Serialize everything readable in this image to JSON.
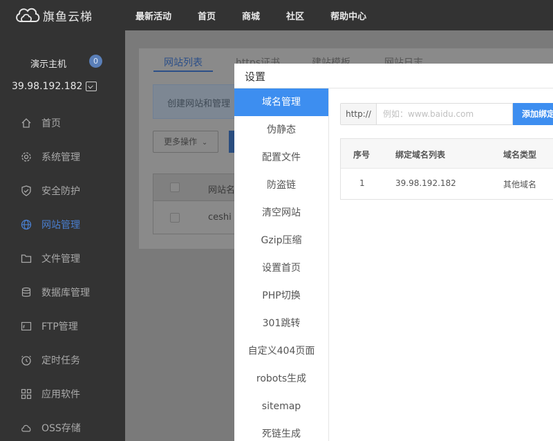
{
  "app": {
    "logo_text": "旗鱼云梯"
  },
  "topnav": [
    "最新活动",
    "首页",
    "商城",
    "社区",
    "帮助中心"
  ],
  "host": {
    "name": "演示主机",
    "count": "0",
    "ip": "39.98.192.182"
  },
  "sidebar": {
    "items": [
      {
        "label": "首页",
        "icon": "home-icon"
      },
      {
        "label": "系统管理",
        "icon": "gear-icon"
      },
      {
        "label": "安全防护",
        "icon": "shield-icon"
      },
      {
        "label": "网站管理",
        "icon": "globe-icon",
        "active": true
      },
      {
        "label": "文件管理",
        "icon": "folder-icon"
      },
      {
        "label": "数据库管理",
        "icon": "database-icon"
      },
      {
        "label": "FTP管理",
        "icon": "ftp-icon"
      },
      {
        "label": "定时任务",
        "icon": "clock-icon"
      },
      {
        "label": "应用软件",
        "icon": "apps-icon"
      },
      {
        "label": "OSS存储",
        "icon": "cloud-storage-icon"
      }
    ]
  },
  "main": {
    "tabs": [
      "网站列表",
      "https证书",
      "建站模板",
      "网站日志"
    ],
    "notice": "创建网站和管理",
    "more_ops": "更多操作",
    "table": {
      "header_name": "网站名",
      "row_name": "ceshi"
    }
  },
  "modal": {
    "title": "设置",
    "menu": [
      "域名管理",
      "伪静态",
      "配置文件",
      "防盗链",
      "清空网站",
      "Gzip压缩",
      "设置首页",
      "PHP切换",
      "301跳转",
      "自定义404页面",
      "robots生成",
      "sitemap",
      "死链生成"
    ],
    "url_prefix": "http://",
    "url_placeholder": "例如：www.baidu.com",
    "add_button": "添加绑定",
    "table": {
      "headers": [
        "序号",
        "绑定域名列表",
        "域名类型"
      ],
      "rows": [
        [
          "1",
          "39.98.192.182",
          "其他域名"
        ]
      ]
    }
  },
  "colors": {
    "accent": "#3d8ef0",
    "topbar": "#333333",
    "sidebar": "#333333"
  }
}
